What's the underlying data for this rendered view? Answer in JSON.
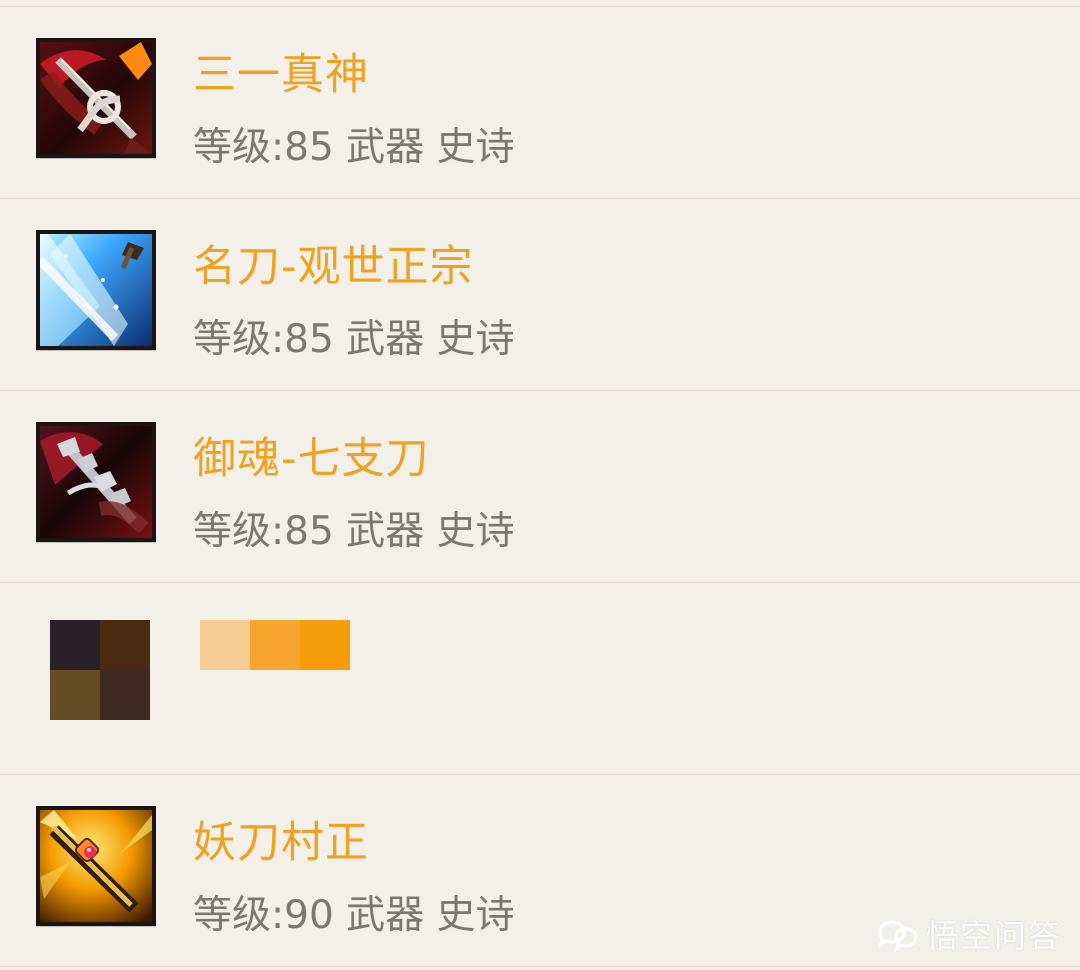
{
  "items": [
    {
      "title": "三一真神",
      "meta": "等级:85 武器 史诗",
      "icon": "weapon-icon"
    },
    {
      "title": "名刀-观世正宗",
      "meta": "等级:85 武器 史诗",
      "icon": "weapon-icon"
    },
    {
      "title": "御魂-七支刀",
      "meta": "等级:85 武器 史诗",
      "icon": "weapon-icon"
    },
    {
      "title": "",
      "meta": "",
      "icon": "placeholder-icon",
      "placeholder_colors": {
        "mosaic": [
          "#2a2128",
          "#4a2b12",
          "#654e24",
          "#3e2a20"
        ],
        "title_blocks": [
          "#f6cc94",
          "#f6a42e",
          "#f59d0b"
        ]
      }
    },
    {
      "title": "妖刀村正",
      "meta": "等级:90 武器 史诗",
      "icon": "weapon-icon"
    }
  ],
  "watermark": {
    "text": "悟空问答",
    "icon": "chat-bubbles-icon"
  },
  "colors": {
    "background": "#f3f0ea",
    "title": "#efa11f",
    "meta": "#7c7770",
    "divider": "#e7d7cf"
  }
}
